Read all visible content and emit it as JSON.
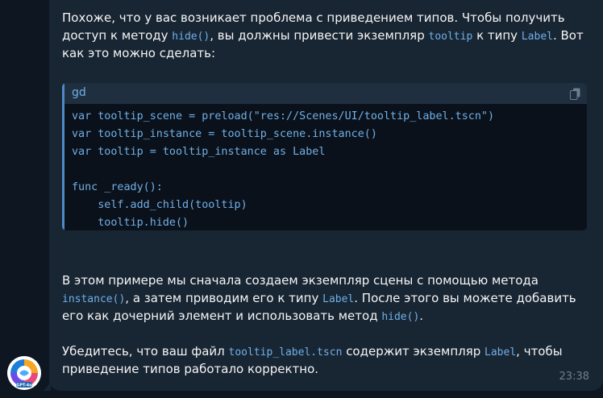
{
  "avatar": {
    "label": "GPT-4o"
  },
  "message": {
    "intro": {
      "line1": "Похоже, что у вас возникает проблема с приведением типов. Чтобы получить",
      "line2_a": "доступ к методу ",
      "line2_code1": "hide()",
      "line2_b": ", вы должны привести экземпляр ",
      "line2_code2": "tooltip",
      "line2_c": " к типу ",
      "line2_code3": "Label",
      "line2_d": ". Вот",
      "line3": "как это можно сделать:"
    },
    "code": {
      "language": "gd",
      "copy_icon": "copy-icon",
      "lines": [
        "var tooltip_scene = preload(\"res://Scenes/UI/tooltip_label.tscn\")",
        "var tooltip_instance = tooltip_scene.instance()",
        "var tooltip = tooltip_instance as Label",
        "",
        "func _ready():",
        "    self.add_child(tooltip)",
        "    tooltip.hide()"
      ]
    },
    "para2": {
      "line1": "В этом примере мы сначала создаем экземпляр сцены с помощью метода",
      "line2_code1": "instance()",
      "line2_a": ", а затем приводим его к типу ",
      "line2_code2": "Label",
      "line2_b": ". После этого вы можете добавить",
      "line3_a": "его как дочерний элемент и использовать метод ",
      "line3_code": "hide()",
      "line3_b": "."
    },
    "para3": {
      "line1_a": "Убедитесь, что ваш файл ",
      "line1_code1": "tooltip_label.tscn",
      "line1_b": " содержит экземпляр ",
      "line1_code2": "Label",
      "line1_c": ", чтобы",
      "line2": "приведение типов работало корректно."
    },
    "time": "23:38"
  }
}
